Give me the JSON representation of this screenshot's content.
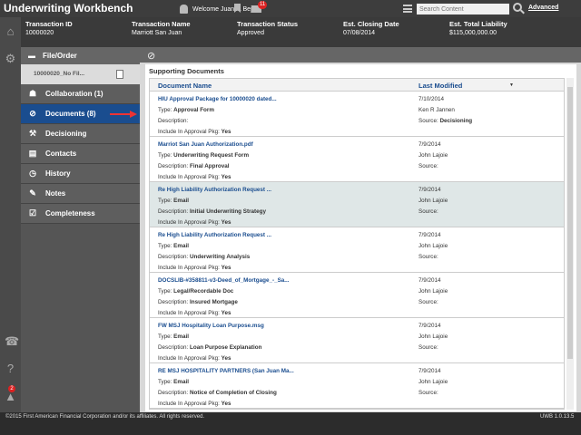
{
  "app": {
    "title": "Underwriting Workbench"
  },
  "topbar": {
    "welcome_text": "Welcome Juanita Bejin",
    "mail_count": "11",
    "search_placeholder": "Search Content",
    "advanced_label": "Advanced",
    "icons": [
      "user-icon",
      "bookmark-icon",
      "mail-icon",
      "menu-icon",
      "search-icon"
    ]
  },
  "transaction": {
    "headers": [
      "Transaction ID",
      "Transaction Name",
      "Transaction Status",
      "Est. Closing Date",
      "Est. Total Liability"
    ],
    "values": [
      "10000020",
      "Marriott San Juan",
      "Approved",
      "07/08/2014",
      "$115,000,000.00"
    ]
  },
  "rail": {
    "notification_count": "2",
    "icons": [
      "home-icon",
      "gear-icon",
      "phone-icon",
      "help-icon",
      "bell-icon"
    ]
  },
  "sidebar": {
    "section_title": "File/Order",
    "sub_item": "10000020_No Fil...",
    "items": [
      {
        "label": "Collaboration (1)",
        "icon": "collaboration-icon"
      },
      {
        "label": "Documents (8)",
        "icon": "paperclip-icon",
        "active": true
      },
      {
        "label": "Decisioning",
        "icon": "gavel-icon"
      },
      {
        "label": "Contacts",
        "icon": "contacts-icon"
      },
      {
        "label": "History",
        "icon": "clock-icon"
      },
      {
        "label": "Notes",
        "icon": "notes-icon"
      },
      {
        "label": "Completeness",
        "icon": "checklist-icon"
      }
    ]
  },
  "documents": {
    "panel_title": "Supporting Documents",
    "columns": [
      "Document Name",
      "Last Modified"
    ],
    "rows": [
      {
        "name": "HIU Approval Package for 10000020 dated...",
        "type": "Approval Form",
        "description": "",
        "include": "Yes",
        "date": "7/10/2014",
        "user": "Ken R Jannen",
        "source": "Decisioning"
      },
      {
        "name": "Marriot San Juan Authorization.pdf",
        "type": "Underwriting Request Form",
        "description": "Final Approval",
        "include": "Yes",
        "date": "7/9/2014",
        "user": "John Lajoie",
        "source": ""
      },
      {
        "name": "Re High Liability Authorization Request ...",
        "type": "Email",
        "description": "Initial Underwriting Strategy",
        "include": "Yes",
        "date": "7/9/2014",
        "user": "John Lajoie",
        "source": "",
        "highlight": true
      },
      {
        "name": "Re High Liability Authorization Request ...",
        "type": "Email",
        "description": "Underwriting Analysis",
        "include": "Yes",
        "date": "7/9/2014",
        "user": "John Lajoie",
        "source": ""
      },
      {
        "name": "DOCSLIB-#358811-v3-Deed_of_Mortgage_-_Sa...",
        "type": "Legal/Recordable Doc",
        "description": "Insured Mortgage",
        "include": "Yes",
        "date": "7/9/2014",
        "user": "John Lajoie",
        "source": ""
      },
      {
        "name": "FW MSJ Hospitality Loan Purpose.msg",
        "type": "Email",
        "description": "Loan Purpose Explanation",
        "include": "Yes",
        "date": "7/9/2014",
        "user": "John Lajoie",
        "source": ""
      },
      {
        "name": "RE MSJ HOSPITALITY PARTNERS (San Juan Ma...",
        "type": "Email",
        "description": "Notice of Completion of Closing",
        "include": "Yes",
        "date": "7/9/2014",
        "user": "John Lajoie",
        "source": ""
      }
    ]
  },
  "labels": {
    "type": "Type:",
    "description": "Description:",
    "include": "Include In Approval Pkg:",
    "source": "Source:"
  },
  "footer": {
    "copyright": "©2015 First American Financial Corporation and/or its affiliates. All rights reserved.",
    "version": "UWB 1.0.13.5"
  }
}
